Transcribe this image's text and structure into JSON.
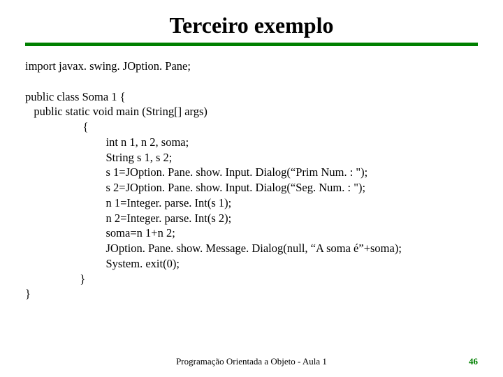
{
  "title": "Terceiro exemplo",
  "code": "import javax. swing. JOption. Pane;\n\npublic class Soma 1 {\n   public static void main (String[] args)\n                    {\n                            int n 1, n 2, soma;\n                            String s 1, s 2;\n                            s 1=JOption. Pane. show. Input. Dialog(“Prim Num. : \");\n                            s 2=JOption. Pane. show. Input. Dialog(“Seg. Num. : \");\n                            n 1=Integer. parse. Int(s 1);\n                            n 2=Integer. parse. Int(s 2);\n                            soma=n 1+n 2;\n                            JOption. Pane. show. Message. Dialog(null, “A soma é”+soma);\n                            System. exit(0);\n                   }\n}",
  "footer": {
    "center": "Programação Orientada a Objeto - Aula 1",
    "page": "46"
  }
}
